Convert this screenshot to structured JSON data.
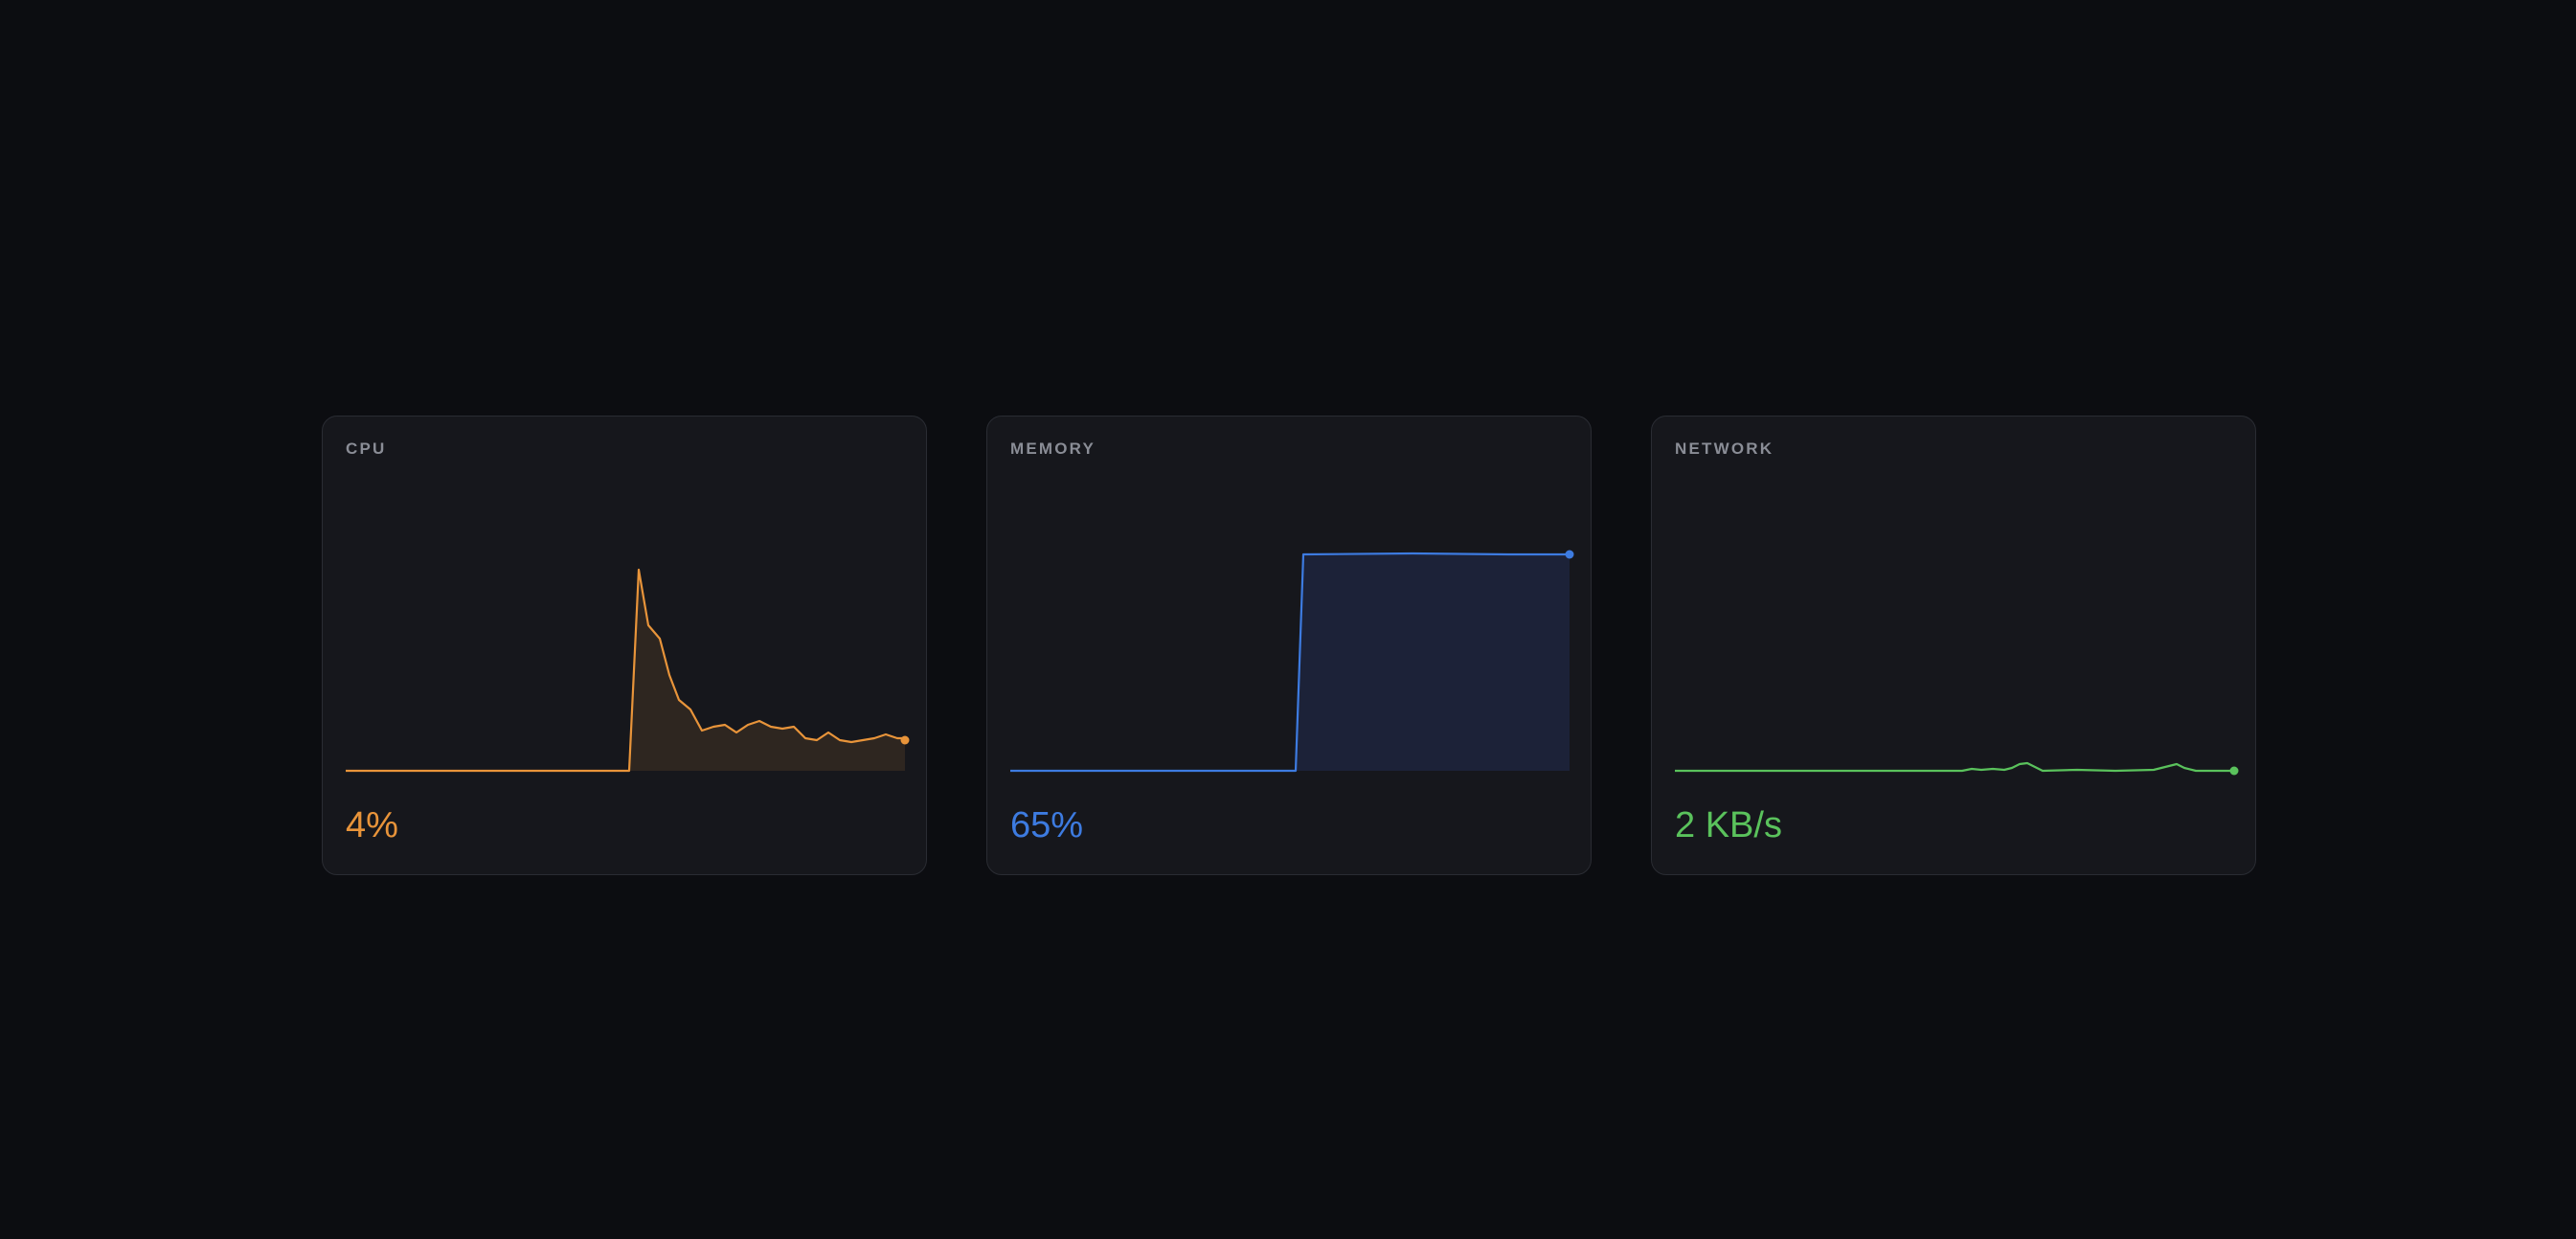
{
  "metrics": [
    {
      "label": "CPU",
      "value": "4%",
      "color": "#e8943a",
      "fill": "#2e2620"
    },
    {
      "label": "MEMORY",
      "value": "65%",
      "color": "#3d7be0",
      "fill": "#1c2238"
    },
    {
      "label": "NETWORK",
      "value": "2 KB/s",
      "color": "#5ac25c",
      "fill": "#17241a"
    }
  ],
  "chart_data": [
    {
      "type": "area",
      "series": [
        {
          "values": [
            0,
            0,
            0,
            0,
            0,
            0,
            0,
            0,
            0,
            0,
            0,
            0,
            0,
            0,
            0,
            0,
            0,
            0,
            0,
            0,
            0,
            0,
            0,
            0,
            0,
            0,
            0,
            0,
            0,
            0,
            0,
            0,
            0,
            0,
            0,
            0,
            0,
            0,
            0,
            0,
            0,
            0,
            0,
            0,
            0,
            0,
            0,
            0,
            0,
            0,
            0,
            0,
            0,
            0,
            0,
            0,
            0,
            0,
            0,
            0,
            0,
            0,
            0,
            0,
            0,
            0,
            0,
            0,
            0,
            0,
            0,
            0,
            0,
            0,
            0,
            0,
            0,
            0,
            0,
            0,
            0,
            0,
            0,
            0,
            0,
            0,
            0,
            0,
            0,
            0,
            0,
            0,
            0,
            0,
            0,
            0,
            0,
            0,
            0,
            0,
            0,
            0,
            0,
            0,
            0,
            0,
            0,
            0,
            0,
            0,
            0,
            0,
            0,
            0,
            0,
            0,
            0,
            0,
            0,
            0,
            0,
            0,
            0,
            0,
            0,
            0,
            0,
            0,
            0,
            0,
            0,
            0,
            0,
            0,
            0,
            0,
            0,
            0,
            0,
            0,
            0,
            0,
            0,
            0,
            0,
            0,
            0,
            0,
            0,
            0,
            0,
            0,
            0,
            0,
            0,
            0,
            0,
            0,
            0,
            0,
            0,
            0,
            0,
            0,
            0,
            0,
            0,
            0,
            0,
            0,
            0,
            0,
            0,
            0,
            0,
            0,
            0,
            0,
            0,
            0,
            0,
            0,
            0,
            0,
            0,
            0,
            0,
            0,
            0,
            0,
            0,
            0,
            0,
            0,
            0,
            0,
            0,
            0,
            0,
            0,
            0,
            0,
            0,
            0,
            0,
            0,
            0,
            0,
            0,
            0,
            0,
            0,
            0,
            0,
            0,
            0,
            0,
            0,
            0,
            0,
            0,
            0,
            0,
            0,
            0,
            0,
            0,
            0,
            0,
            0,
            0,
            0,
            0,
            0,
            0,
            0,
            0,
            0,
            0,
            0,
            0,
            0,
            0,
            0,
            0,
            0,
            0,
            0,
            0,
            0,
            0,
            0,
            0,
            0,
            0,
            0,
            0,
            0,
            0,
            0,
            0,
            0,
            0,
            0,
            0,
            0,
            0,
            0,
            0,
            0,
            0,
            0,
            0,
            0,
            0,
            0,
            0,
            0,
            0,
            0,
            0,
            0,
            0,
            0,
            0,
            0,
            0,
            0,
            0,
            0,
            0,
            0,
            0,
            0,
            0,
            0,
            0,
            0,
            0,
            0,
            0,
            0,
            0,
            0,
            0,
            0,
            0,
            0
          ]
        }
      ],
      "ylim": [
        0,
        100
      ]
    }
  ]
}
